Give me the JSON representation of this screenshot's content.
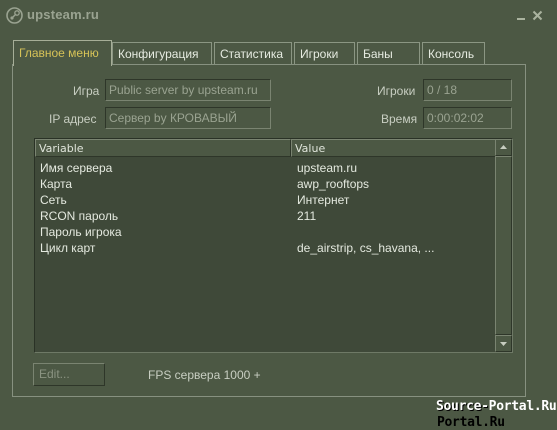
{
  "app": {
    "title": "upsteam.ru",
    "logo_icon": "steam-logo-icon"
  },
  "tabs": [
    {
      "label": "Главное меню",
      "active": true
    },
    {
      "label": "Конфигурация",
      "active": false
    },
    {
      "label": "Статистика",
      "active": false
    },
    {
      "label": "Игроки",
      "active": false
    },
    {
      "label": "Баны",
      "active": false
    },
    {
      "label": "Консоль",
      "active": false
    }
  ],
  "fields": {
    "game_label": "Игра",
    "game_value": "Public server by upsteam.ru",
    "ip_label": "IP адрес",
    "ip_value": "Сервер by КРОВАВЫЙ",
    "players_label": "Игроки",
    "players_value": "0 / 18",
    "time_label": "Время",
    "time_value": "0:00:02:02"
  },
  "table": {
    "columns": [
      "Variable",
      "Value"
    ],
    "rows": [
      {
        "key": "Имя сервера",
        "value": "upsteam.ru"
      },
      {
        "key": "Карта",
        "value": "awp_rooftops"
      },
      {
        "key": "Сеть",
        "value": "Интернет"
      },
      {
        "key": "RCON пароль",
        "value": "211"
      },
      {
        "key": "Пароль игрока",
        "value": ""
      },
      {
        "key": "Цикл карт",
        "value": "de_airstrip, cs_havana, ..."
      }
    ]
  },
  "footer": {
    "edit_label": "Edit...",
    "fps_text": "FPS сервера 1000 +"
  },
  "watermark": "Source-Portal.Ru",
  "colors": {
    "background": "#4c5844",
    "active_tab_text": "#d6c257",
    "list_background": "#3f4939"
  }
}
